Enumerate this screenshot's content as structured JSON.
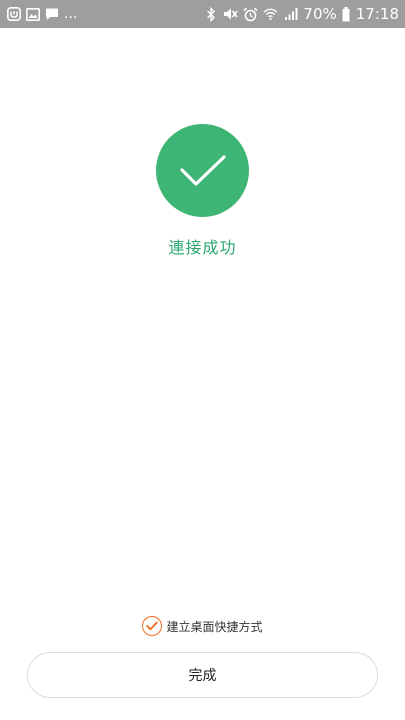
{
  "status_bar": {
    "notification_dots": "...",
    "battery_percent": "70%",
    "time": "17:18",
    "icons": [
      "mi-home-icon",
      "image-icon",
      "message-icon",
      "bluetooth-icon",
      "mute-icon",
      "alarm-icon",
      "wifi-icon",
      "signal-icon",
      "battery-icon"
    ]
  },
  "result": {
    "title": "連接成功",
    "icon": "check-icon",
    "accent_color": "#3db575"
  },
  "shortcut": {
    "label": "建立桌面快捷方式",
    "checked": true,
    "check_color": "#ef6c1f"
  },
  "done_button": {
    "label": "完成"
  }
}
